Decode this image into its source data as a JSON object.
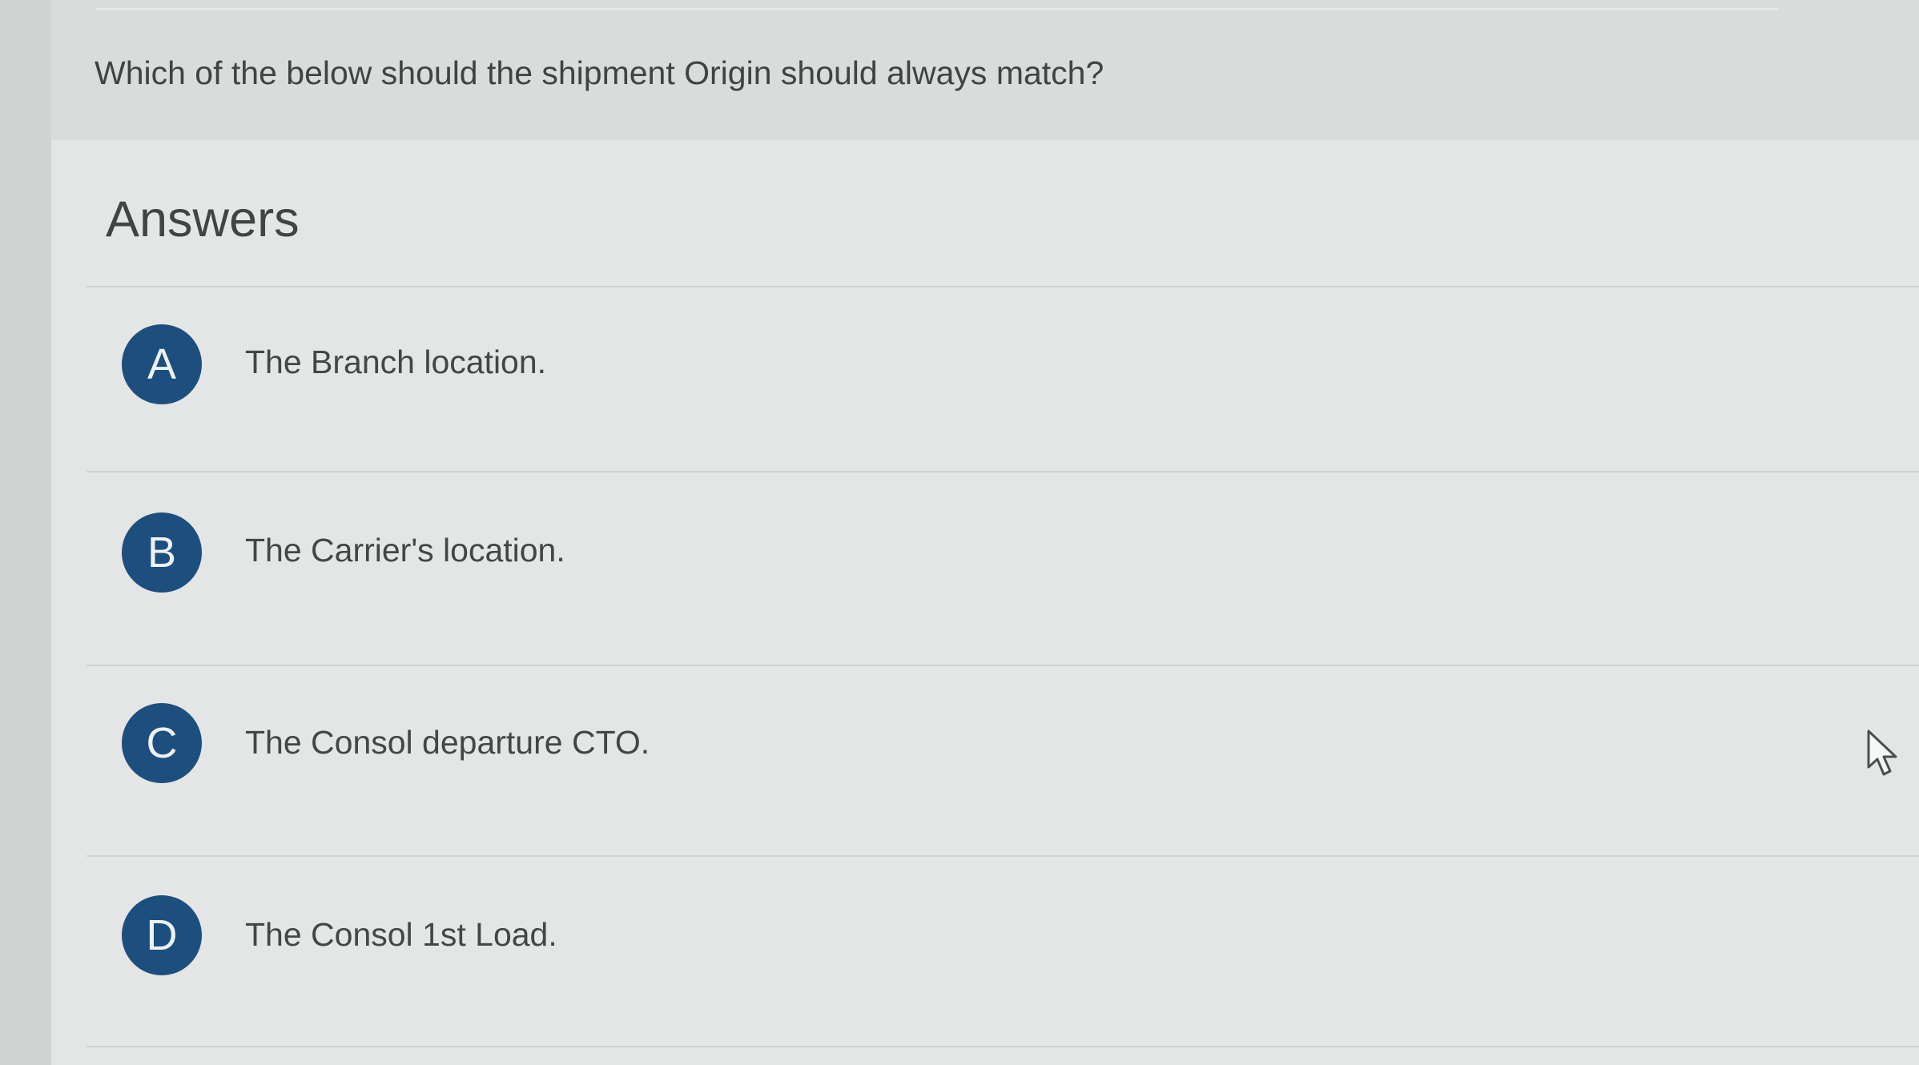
{
  "question": {
    "text": "Which of the below should the shipment Origin should always match?"
  },
  "answers_section": {
    "title": "Answers",
    "options": [
      {
        "letter": "A",
        "text": "The Branch location."
      },
      {
        "letter": "B",
        "text": "The Carrier's location."
      },
      {
        "letter": "C",
        "text": "The Consol departure CTO."
      },
      {
        "letter": "D",
        "text": "The Consol 1st Load."
      }
    ]
  },
  "colors": {
    "badge": "#1d4f7e",
    "badge_text": "#eef2f5",
    "text": "#414747",
    "card_background": "#e4e6e5"
  },
  "icons": {
    "cursor": "mouse-pointer-icon"
  }
}
